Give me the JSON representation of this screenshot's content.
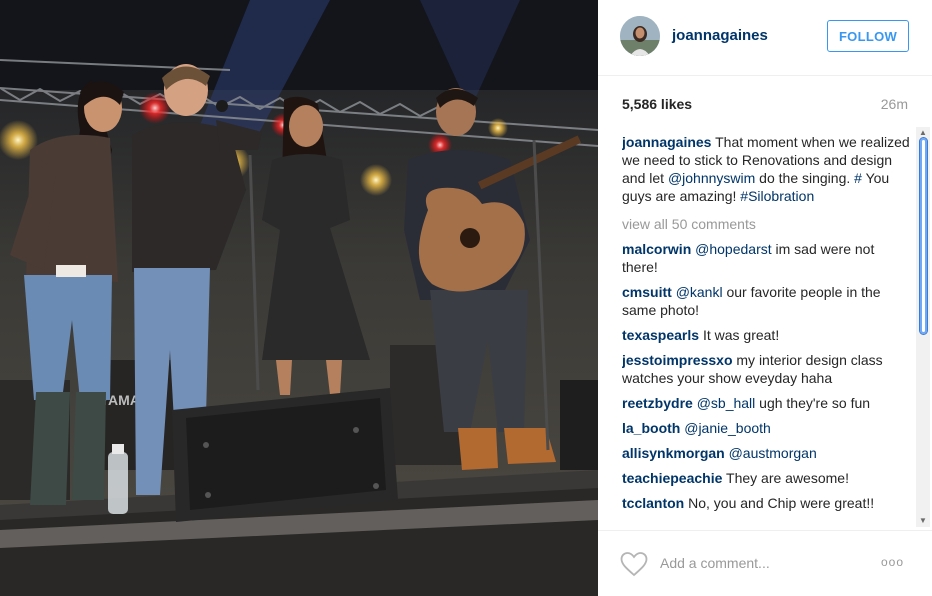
{
  "post": {
    "username": "joannagaines",
    "follow_label": "FOLLOW",
    "likes": "5,586 likes",
    "time_ago": "26m",
    "caption": {
      "user": "joannagaines",
      "text_1": " That moment when we realized we need to stick to Renovations and design and let ",
      "mention": "@johnnyswim",
      "text_2": " do the singing. ",
      "tag_1": "#",
      "text_3": " You guys are amazing! ",
      "tag_2": "#Silobration"
    },
    "view_all": "view all 50 comments",
    "comments": [
      {
        "user": "malcorwin",
        "mention": "@hopedarst",
        "text": " im sad were not there!"
      },
      {
        "user": "cmsuitt",
        "mention": "@kankl",
        "text": " our favorite people in the same photo!"
      },
      {
        "user": "texaspearls",
        "mention": "",
        "text": " It was great!"
      },
      {
        "user": "jesstoimpressxo",
        "mention": "",
        "text": " my interior design class watches your show eveyday haha"
      },
      {
        "user": "reetzbydre",
        "mention": "@sb_hall",
        "text": " ugh they're so fun"
      },
      {
        "user": "la_booth",
        "mention": "@janie_booth",
        "text": ""
      },
      {
        "user": "allisynkmorgan",
        "mention": "@austmorgan",
        "text": ""
      },
      {
        "user": "teachiepeachie",
        "mention": "",
        "text": " They are awesome!"
      },
      {
        "user": "tcclanton",
        "mention": "",
        "text": " No, you and Chip were great!!"
      }
    ],
    "add_comment_placeholder": "Add a comment...",
    "more_glyph": "ooo",
    "photo_text": "YAMAHA",
    "icons": {
      "like": "heart-icon",
      "more": "more-options-icon"
    },
    "colors": {
      "username": "#003569",
      "follow": "#3897f0",
      "muted": "#999999"
    }
  }
}
